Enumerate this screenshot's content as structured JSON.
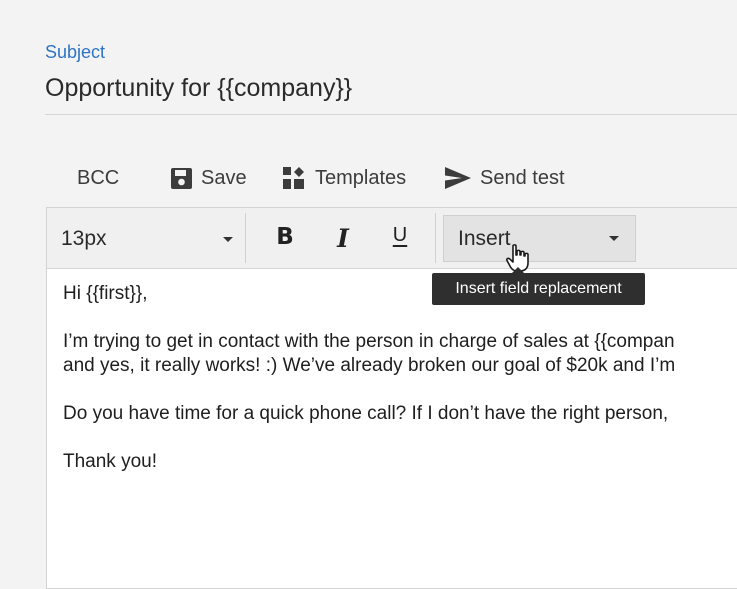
{
  "subject": {
    "label": "Subject",
    "value": "Opportunity for {{company}}"
  },
  "toolbar": {
    "bcc_label": "BCC",
    "save_label": "Save",
    "templates_label": "Templates",
    "send_test_label": "Send test"
  },
  "format_bar": {
    "font_size_value": "13px",
    "bold_label": "B",
    "italic_label": "I",
    "underline_label": "U",
    "insert_value": "Insert"
  },
  "tooltip": {
    "text": "Insert field replacement"
  },
  "email_body": {
    "paragraphs": [
      {
        "lines": [
          "Hi {{first}},"
        ]
      },
      {
        "lines": [
          "I’m trying to get in contact with the person in charge of sales at {{compan",
          "and yes, it really works! :) We’ve already broken our goal of $20k and I’m"
        ]
      },
      {
        "lines": [
          "Do you have time for a quick phone call? If I don’t have the right person,"
        ]
      },
      {
        "lines": [
          "Thank you!"
        ]
      }
    ]
  },
  "icons": {
    "save": "floppy-disk-icon",
    "templates": "templates-grid-icon",
    "send_test": "send-arrow-icon",
    "dropdown": "caret-down-icon",
    "cursor": "hand-pointer-icon"
  },
  "colors": {
    "accent": "#2f74c4",
    "tooltip_bg": "#2f2f2f"
  }
}
